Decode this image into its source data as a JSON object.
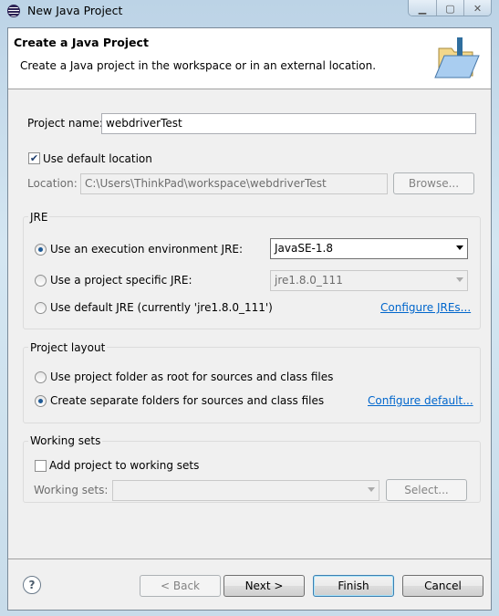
{
  "window": {
    "title": "New Java Project",
    "icon": "eclipse-icon",
    "controls": [
      "minimize",
      "maximize",
      "close"
    ]
  },
  "header": {
    "title": "Create a Java Project",
    "description": "Create a Java project in the workspace or in an external location.",
    "icon": "new-java-project-folder-icon"
  },
  "project": {
    "name_label": "Project name:",
    "name_value": "webdriverTest",
    "use_default_location_label": "Use default location",
    "use_default_location_checked": true,
    "location_label": "Location:",
    "location_value": "C:\\Users\\ThinkPad\\workspace\\webdriverTest",
    "browse_label": "Browse..."
  },
  "jre": {
    "group_label": "JRE",
    "options": [
      {
        "label": "Use an execution environment JRE:",
        "selected": true,
        "combo": "JavaSE-1.8"
      },
      {
        "label": "Use a project specific JRE:",
        "selected": false,
        "combo": "jre1.8.0_111"
      },
      {
        "label": "Use default JRE (currently 'jre1.8.0_111')",
        "selected": false
      }
    ],
    "configure_link": "Configure JREs..."
  },
  "layout": {
    "group_label": "Project layout",
    "options": [
      {
        "label": "Use project folder as root for sources and class files",
        "selected": false
      },
      {
        "label": "Create separate folders for sources and class files",
        "selected": true
      }
    ],
    "configure_link": "Configure default..."
  },
  "working_sets": {
    "group_label": "Working sets",
    "add_label": "Add project to working sets",
    "add_checked": false,
    "sets_label": "Working sets:",
    "sets_value": "",
    "select_label": "Select..."
  },
  "footer": {
    "back": "< Back",
    "next": "Next >",
    "finish": "Finish",
    "cancel": "Cancel"
  }
}
